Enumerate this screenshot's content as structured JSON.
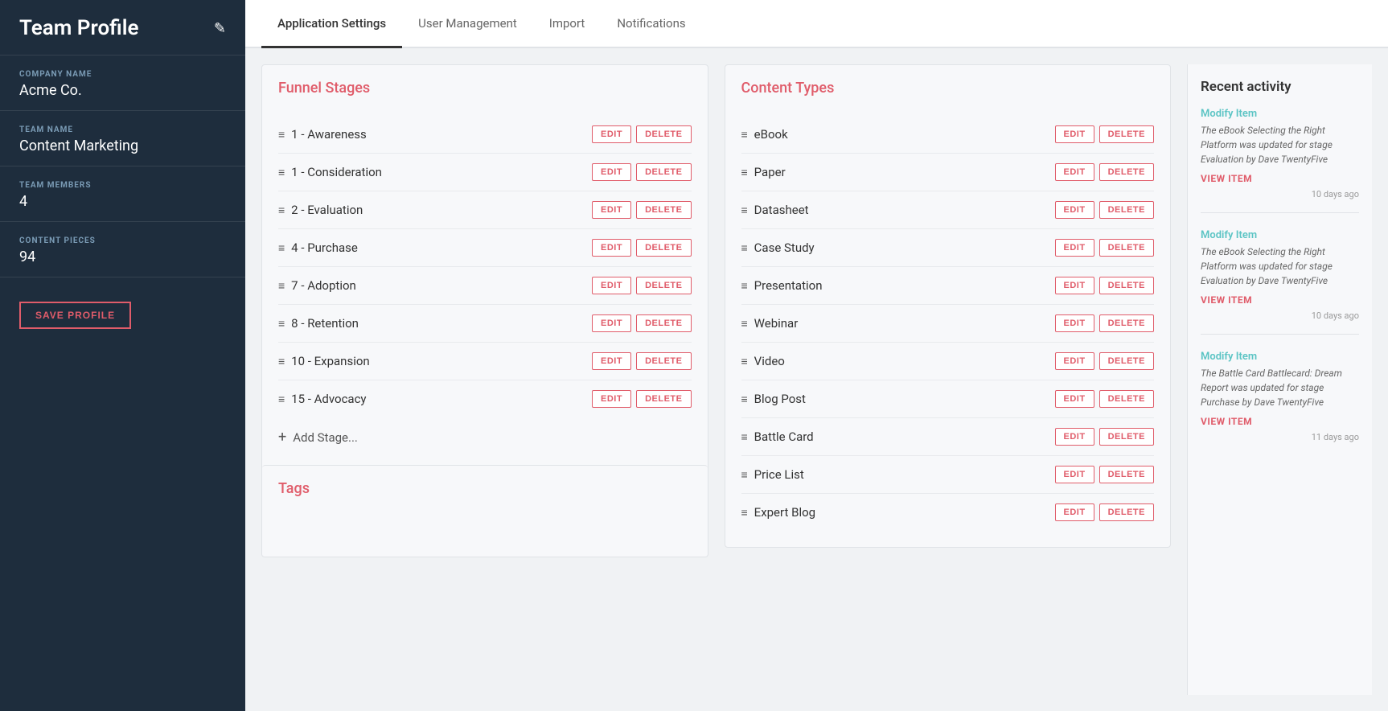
{
  "sidebar": {
    "title": "Team Profile",
    "edit_icon": "✎",
    "company_label": "COMPANY NAME",
    "company_value": "Acme Co.",
    "team_label": "TEAM NAME",
    "team_value": "Content Marketing",
    "members_label": "TEAM MEMBERS",
    "members_value": "4",
    "pieces_label": "CONTENT PIECES",
    "pieces_value": "94",
    "save_button": "SAVE PROFILE"
  },
  "tabs": [
    {
      "id": "app-settings",
      "label": "Application Settings",
      "active": true
    },
    {
      "id": "user-management",
      "label": "User Management",
      "active": false
    },
    {
      "id": "import",
      "label": "Import",
      "active": false
    },
    {
      "id": "notifications",
      "label": "Notifications",
      "active": false
    }
  ],
  "funnel_stages": {
    "title": "Funnel Stages",
    "items": [
      {
        "label": "1 - Awareness"
      },
      {
        "label": "1 - Consideration"
      },
      {
        "label": "2 - Evaluation"
      },
      {
        "label": "4 - Purchase"
      },
      {
        "label": "7 - Adoption"
      },
      {
        "label": "8 - Retention"
      },
      {
        "label": "10 - Expansion"
      },
      {
        "label": "15 - Advocacy"
      }
    ],
    "add_label": "Add Stage...",
    "edit_btn": "EDIT",
    "delete_btn": "DELETE"
  },
  "tags": {
    "title": "Tags"
  },
  "content_types": {
    "title": "Content Types",
    "items": [
      {
        "label": "eBook"
      },
      {
        "label": "Paper"
      },
      {
        "label": "Datasheet"
      },
      {
        "label": "Case Study"
      },
      {
        "label": "Presentation"
      },
      {
        "label": "Webinar"
      },
      {
        "label": "Video"
      },
      {
        "label": "Blog Post"
      },
      {
        "label": "Battle Card"
      },
      {
        "label": "Price List"
      },
      {
        "label": "Expert Blog"
      }
    ],
    "edit_btn": "EDIT",
    "delete_btn": "DELETE"
  },
  "recent_activity": {
    "title": "Recent activity",
    "items": [
      {
        "modify_label": "Modify Item",
        "description": "The eBook Selecting the Right Platform was updated for stage Evaluation by Dave TwentyFive",
        "view_label": "VIEW ITEM",
        "time": "10 days ago"
      },
      {
        "modify_label": "Modify Item",
        "description": "The eBook Selecting the Right Platform was updated for stage Evaluation by Dave TwentyFive",
        "view_label": "VIEW ITEM",
        "time": "10 days ago"
      },
      {
        "modify_label": "Modify Item",
        "description": "The Battle Card Battlecard: Dream Report was updated for stage Purchase by Dave TwentyFive",
        "view_label": "VIEW ITEM",
        "time": "11 days ago"
      }
    ]
  }
}
